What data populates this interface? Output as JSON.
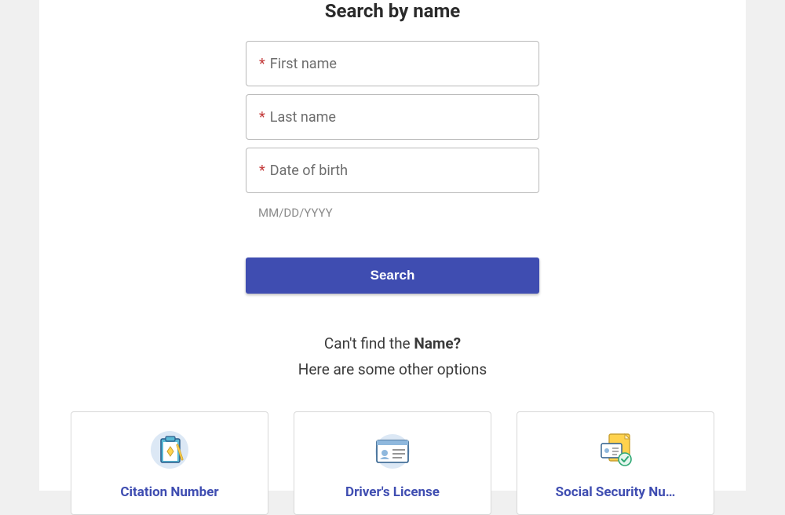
{
  "heading": "Search by name",
  "fields": {
    "first_name": {
      "label": "First name",
      "required": true
    },
    "last_name": {
      "label": "Last name",
      "required": true
    },
    "dob": {
      "label": "Date of birth",
      "required": true,
      "hint": "MM/DD/YYYY"
    }
  },
  "search_button": "Search",
  "cant_find": {
    "prefix": "Can't find the ",
    "bold": "Name?",
    "sub": "Here are some other options"
  },
  "options": [
    {
      "label": "Citation Number",
      "icon": "clipboard-icon"
    },
    {
      "label": "Driver's License",
      "icon": "id-card-icon"
    },
    {
      "label": "Social Security Nu…",
      "icon": "document-check-icon"
    }
  ]
}
